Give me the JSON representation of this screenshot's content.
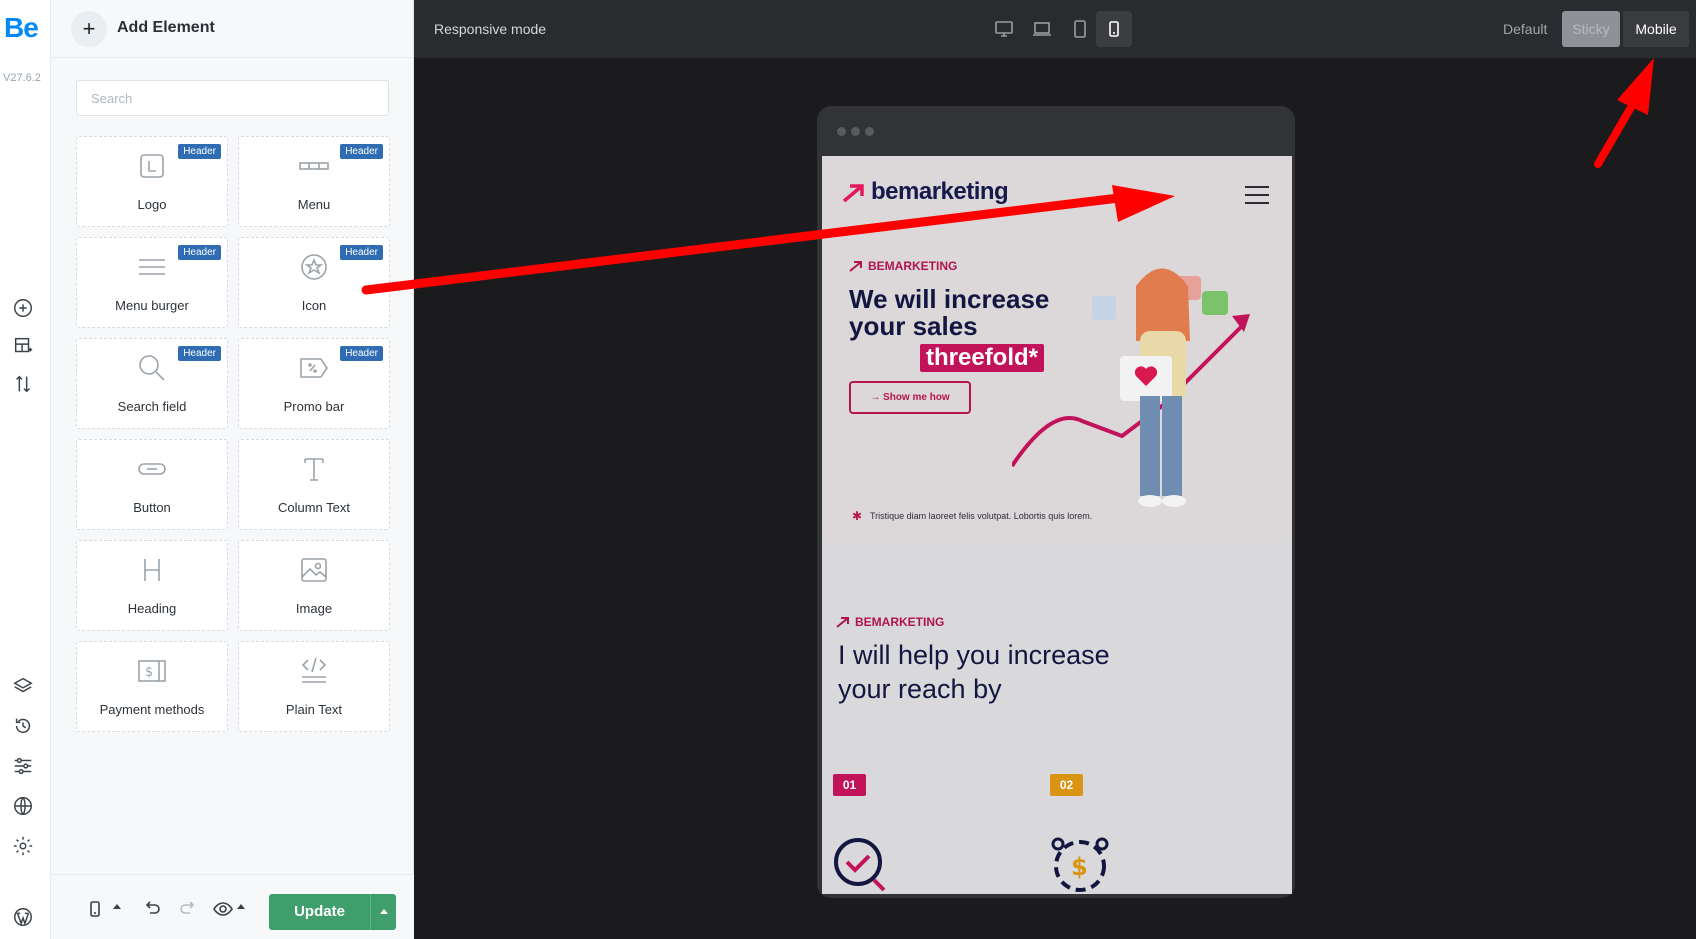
{
  "brand": {
    "logo_text": "Be",
    "version": "V27.6.2"
  },
  "panel": {
    "title": "Add Element",
    "search_placeholder": "Search",
    "elements": [
      {
        "label": "Logo",
        "tag": "Header",
        "icon": "logo-icon"
      },
      {
        "label": "Menu",
        "tag": "Header",
        "icon": "menu-icon"
      },
      {
        "label": "Menu burger",
        "tag": "Header",
        "icon": "burger-icon"
      },
      {
        "label": "Icon",
        "tag": "Header",
        "icon": "star-icon"
      },
      {
        "label": "Search field",
        "tag": "Header",
        "icon": "search-icon"
      },
      {
        "label": "Promo bar",
        "tag": "Header",
        "icon": "promo-tag-icon"
      },
      {
        "label": "Button",
        "tag": "",
        "icon": "button-icon"
      },
      {
        "label": "Column Text",
        "tag": "",
        "icon": "text-icon"
      },
      {
        "label": "Heading",
        "tag": "",
        "icon": "heading-icon"
      },
      {
        "label": "Image",
        "tag": "",
        "icon": "image-icon"
      },
      {
        "label": "Payment methods",
        "tag": "",
        "icon": "payment-icon"
      },
      {
        "label": "Plain Text",
        "tag": "",
        "icon": "code-icon"
      }
    ],
    "update_label": "Update"
  },
  "topbar": {
    "responsive_label": "Responsive mode",
    "modes": {
      "default": "Default",
      "sticky": "Sticky",
      "mobile": "Mobile"
    },
    "devices": [
      "desktop-icon",
      "laptop-icon",
      "tablet-icon",
      "mobile-icon"
    ],
    "active_device": "mobile-icon"
  },
  "preview": {
    "brand_name": "bemarketing",
    "hero_eyebrow": "BEMARKETING",
    "hero_title": "We will increase your sales",
    "hero_highlight": "threefold*",
    "hero_button": "→ Show me how",
    "hero_note": "Tristique diam laoreet felis volutpat. Lobortis quis lorem.",
    "section_eyebrow": "BEMARKETING",
    "section_title": "I will help you increase your reach by",
    "badges": [
      {
        "label": "01",
        "color": "#c2135a"
      },
      {
        "label": "02",
        "color": "#d89412"
      }
    ]
  },
  "colors": {
    "accent_blue": "#0089f7",
    "update_green": "#3f9e6b",
    "brand_pink": "#c2135a",
    "annotation_red": "#ff0000"
  }
}
